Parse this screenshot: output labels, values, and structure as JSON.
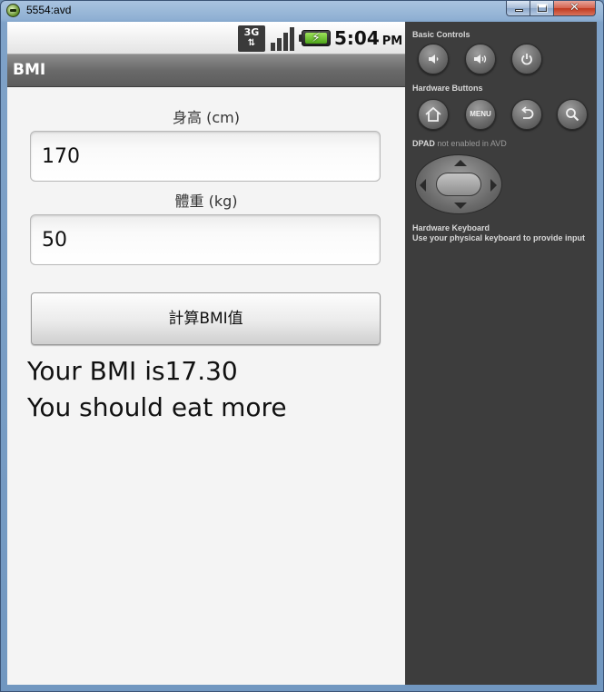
{
  "window": {
    "title": "5554:avd",
    "close_glyph": "✕"
  },
  "statusbar": {
    "network": "3G",
    "network_arrows": "⇅",
    "battery_glyph": "⚡",
    "time": "5:04",
    "ampm": "PM"
  },
  "app": {
    "title": "BMI",
    "height_label": "身高 (cm)",
    "height_value": "170",
    "weight_label": "體重 (kg)",
    "weight_value": "50",
    "calc_button": "計算BMI值",
    "result_line1": "Your BMI is17.30",
    "result_line2": "You should eat more"
  },
  "panel": {
    "basic_controls": "Basic Controls",
    "hardware_buttons": "Hardware Buttons",
    "dpad_prefix": "DPAD",
    "dpad_note": "not enabled in AVD",
    "keyboard_title": "Hardware Keyboard",
    "keyboard_note": "Use your physical keyboard to provide input",
    "menu_label": "MENU",
    "icons": [
      "volume-down-icon",
      "volume-up-icon",
      "power-icon",
      "home-icon",
      "menu-icon",
      "back-icon",
      "search-icon"
    ]
  }
}
